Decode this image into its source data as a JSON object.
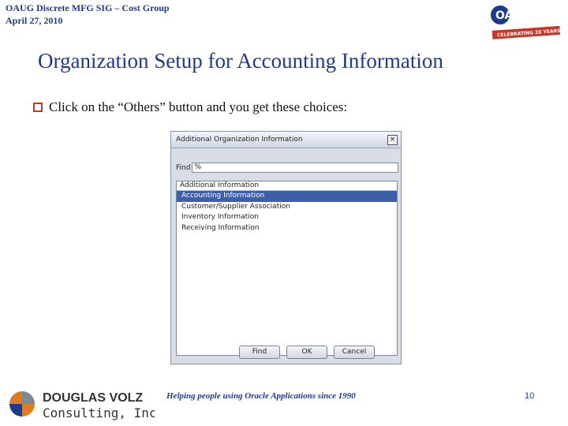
{
  "header": {
    "line1": "OAUG Discrete MFG SIG – Cost Group",
    "line2": "April 27, 2010"
  },
  "logo_top": {
    "name": "OAUG",
    "tagline": "CELEBRATING 20 YEARS"
  },
  "slide": {
    "title": "Organization Setup for Accounting Information",
    "bullet": "Click on the “Others” button and you get these choices:"
  },
  "dialog": {
    "title": "Additional Organization Information",
    "find_label": "Find",
    "find_value": "%",
    "column_header": "Additional Information",
    "items": [
      "Accounting Information",
      "Customer/Supplier Association",
      "Inventory Information",
      "Receiving Information"
    ],
    "selected_index": 0,
    "buttons": {
      "find": "Find",
      "ok": "OK",
      "cancel": "Cancel"
    }
  },
  "footer": {
    "logo_line1": "DOUGLAS VOLZ",
    "logo_line2": "Consulting, Inc.",
    "tagline": "Helping people using Oracle Applications since 1990",
    "page_number": "10"
  },
  "colors": {
    "brand_blue": "#1f3a8a",
    "selection": "#3d5fa8",
    "bullet": "#c0392b"
  }
}
